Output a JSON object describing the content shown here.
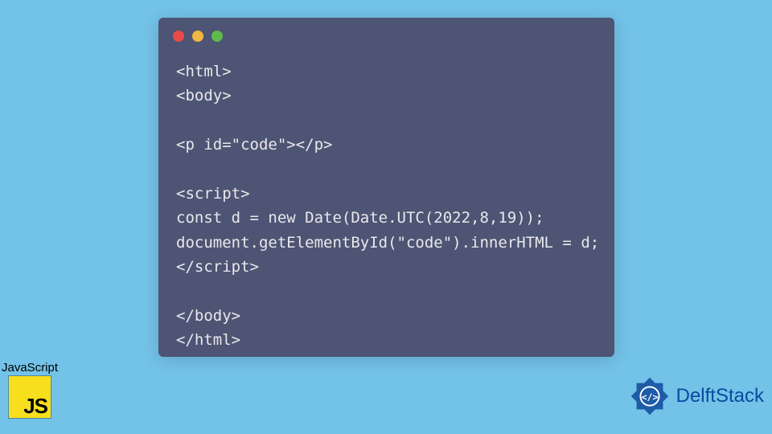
{
  "code": {
    "lines": [
      "<html>",
      "<body>",
      "",
      "<p id=\"code\"></p>",
      "",
      "<script>",
      "const d = new Date(Date.UTC(2022,8,19));",
      "document.getElementById(\"code\").innerHTML = d;",
      "</script>",
      "",
      "</body>",
      "</html>"
    ]
  },
  "badges": {
    "js_label": "JavaScript",
    "js_logo_text": "JS",
    "delftstack_text": "DelftStack"
  }
}
